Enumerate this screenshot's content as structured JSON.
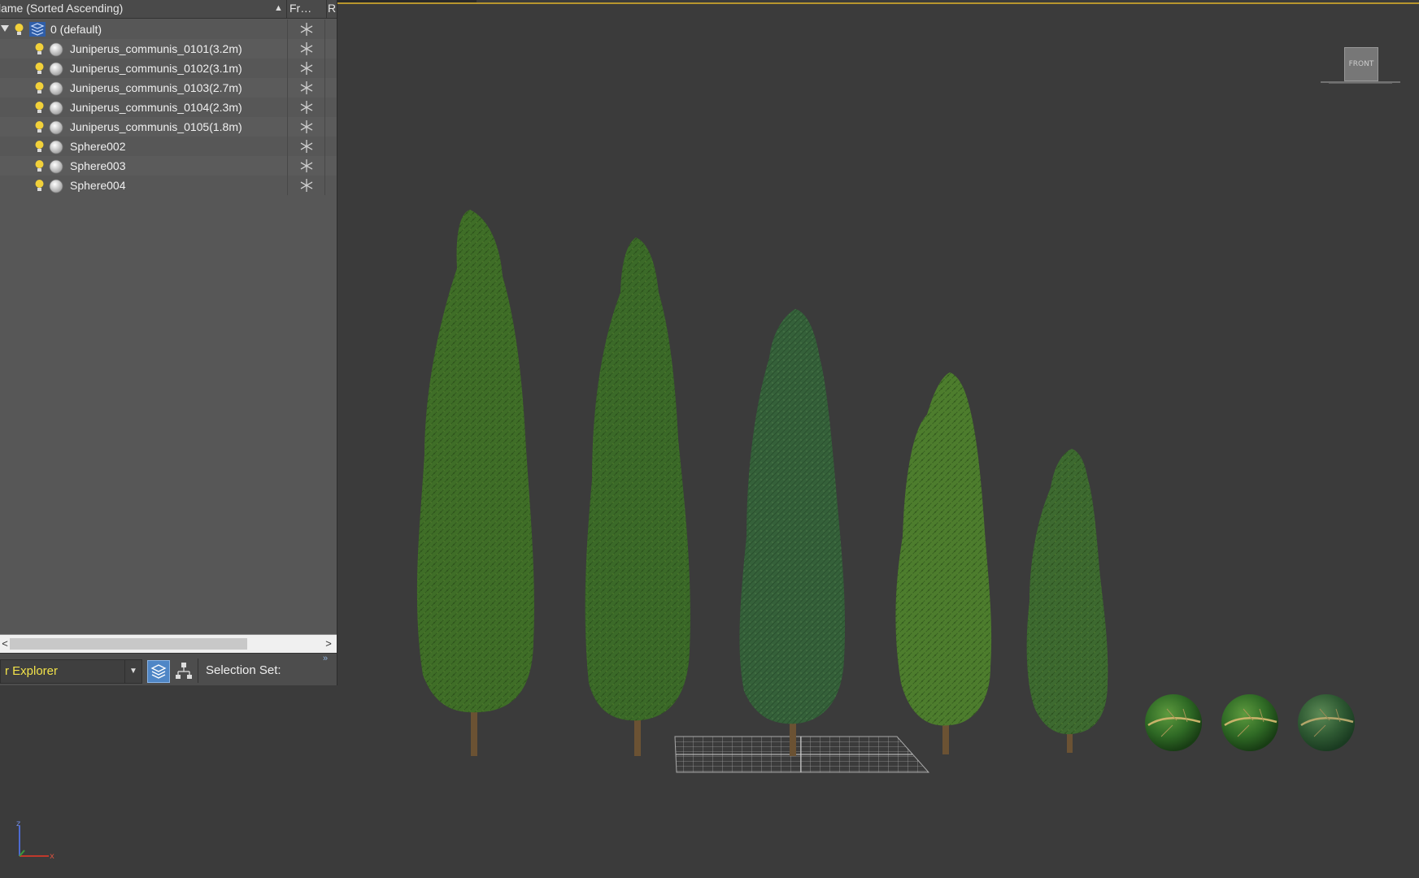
{
  "explorer": {
    "columns": {
      "name": "lame (Sorted Ascending)",
      "sort_indicator": "▲",
      "freeze": "Fr…",
      "render": "R"
    },
    "layer": {
      "label": "0 (default)"
    },
    "objects": [
      {
        "label": "Juniperus_communis_0101(3.2m)"
      },
      {
        "label": "Juniperus_communis_0102(3.1m)"
      },
      {
        "label": "Juniperus_communis_0103(2.7m)"
      },
      {
        "label": "Juniperus_communis_0104(2.3m)"
      },
      {
        "label": "Juniperus_communis_0105(1.8m)"
      },
      {
        "label": "Sphere002"
      },
      {
        "label": "Sphere003"
      },
      {
        "label": "Sphere004"
      }
    ],
    "scrollbar": {
      "left_arrow": "<",
      "right_arrow": ">"
    },
    "bottom_bar": {
      "explorer_type": "r Explorer",
      "selection_set_label": "Selection Set:",
      "overflow": "»"
    }
  },
  "viewport": {
    "viewcube_label": "FRONT",
    "axes": {
      "z": "z",
      "x": "x"
    },
    "border_color": "#b8962e",
    "background_color": "#3b3b3b"
  },
  "colors": {
    "explorer_label": "#f2e24a",
    "active_toolbar_button": "#4f86c6",
    "bulb": "#f2d13a"
  }
}
